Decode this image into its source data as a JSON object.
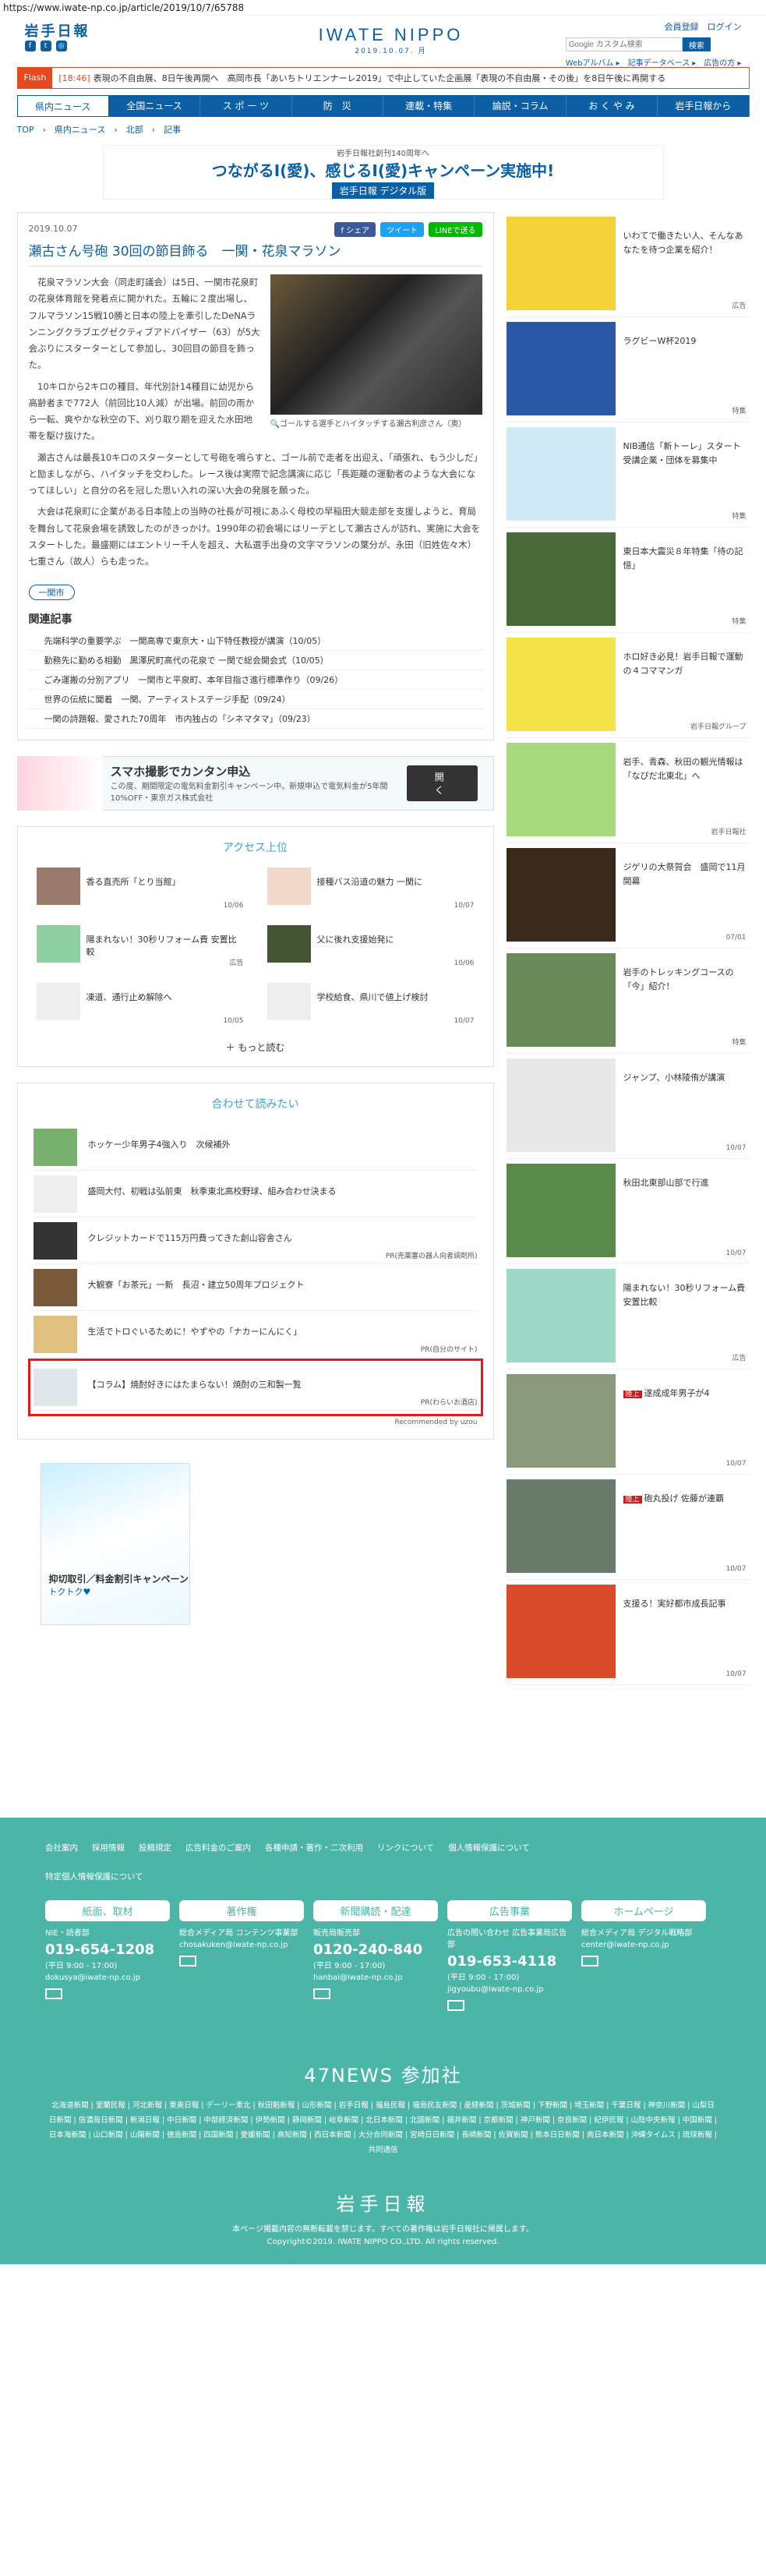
{
  "url": "https://www.iwate-np.co.jp/article/2019/10/7/65788",
  "header": {
    "logo": "岩手日報",
    "brand_main": "IWATE NIPPO",
    "brand_date": "2019.10.07. 月",
    "top_links": "会員登録　ログイン",
    "search_placeholder": "Google カスタム検索",
    "search_button": "検索",
    "sub_links": "Webアルバム ▸　記事データベース ▸　広告の方 ▸"
  },
  "flash": {
    "tag": "Flash",
    "time": "[18:46]",
    "text": "表現の不自由展、8日午後再開へ　高岡市長「あいちトリエンナーレ2019」で中止していた企画展「表現の不自由展・その後」を8日午後に再開する"
  },
  "nav": [
    "県内ニュース",
    "全国ニュース",
    "ス ポ ー ツ",
    "防　災",
    "連載・特集",
    "論説・コラム",
    "お く や み",
    "岩手日報から"
  ],
  "breadcrumb": "TOP　›　県内ニュース　›　北部　›　記事",
  "top_ad": {
    "small": "岩手日報社創刊140周年へ",
    "main": "つながるI(愛)、感じるI(愛)キャンペーン実施中!",
    "logo": "岩手日報 デジタル版"
  },
  "article": {
    "date": "2019.10.07",
    "share": [
      "f シェア",
      "ツイート",
      "LINEで送る"
    ],
    "title": "瀬古さん号砲 30回の節目飾る　一関・花泉マラソン",
    "photo_caption": "ゴールする選手とハイタッチする瀬古利彦さん（奥）",
    "paragraphs": [
      "花泉マラソン大会（同走町議会）は5日、一関市花泉町の花泉体育館を発着点に開かれた。五輪に２度出場し、フルマラソン15戦10勝と日本の陸上を牽引したDeNAランニングクラブエグゼクティブアドバイザー（63）が5大会ぶりにスターターとして参加し、30回目の節目を飾った。",
      "10キロから2キロの種目、年代別計14種目に幼児から高齢者まで772人（前回比10人減）が出場。前回の雨から一転、爽やかな秋空の下、刈り取り期を迎えた水田地帯を駆け抜けた。",
      "瀬古さんは最長10キロのスターターとして号砲を鳴らすと、ゴール前で走者を出迎え、「頑張れ、もう少しだ」と励ましながら、ハイタッチを交わした。レース後は実際で記念講演に応じ「長距離の運動者のような大会になってほしい」と自分の名を冠した思い入れの深い大会の発展を願った。",
      "大会は花泉町に企業がある日本陸上の当時の社長が可視にあふく母校の早稲田大競走部を支援しようと、育局を舞台して花泉会場を誘致したのがきっかけ。1990年の初会場にはリーデとして瀬古さんが訪れ、実施に大会をスタートした。最盛期にはエントリー千人を超え、大私選手出身の文字マラソンの葉分が、永田（旧姓佐々木）七重さん（故人）らも走った。"
    ],
    "tag": "一関市"
  },
  "related": {
    "heading": "関連記事",
    "items": [
      "先端科学の重要学ぶ　一関高専で東京大・山下特任教授が講演（10/05）",
      "勤務先に勤める相勤　黒澤尻町高代の花泉で 一関で総会開会式（10/05）",
      "ごみ運搬の分別アプリ　一関市と平泉町、本年目指さ進行標準作り（09/26）",
      "世界の伝統に聞着　一関、アーティストステージ手配（09/24）",
      "一関の詩題報、愛された70周年　市内独占の「シネマタマ」（09/23）"
    ]
  },
  "mid_ad": {
    "title": "スマホ撮影でカンタン申込",
    "desc": "この度、期間限定の電気料金割引キャンペーン中。新規申込で電気料金が5年間10%OFF・東京ガス株式会社",
    "button": "開く"
  },
  "ranking": {
    "heading": "アクセス上位",
    "items": [
      {
        "title": "香る直売所「とり当館」",
        "date": "10/06"
      },
      {
        "title": "接種バス沿道の魅力 一関に",
        "date": "10/07"
      },
      {
        "title": "陽まれない！30秒リフォーム費 安置比較",
        "date": "広告"
      },
      {
        "title": "父に後れ支援始発に",
        "date": "10/06"
      },
      {
        "title": "凍道、通行止め解除へ",
        "date": "10/05"
      },
      {
        "title": "学校給食、県川で値上げ検討",
        "date": "10/07"
      }
    ],
    "more": "もっと読む"
  },
  "recommend": {
    "heading": "合わせて読みたい",
    "items": [
      {
        "title": "ホッケー少年男子4強入り　次候補外",
        "pr": ""
      },
      {
        "title": "盛岡大付、初戦は弘前東　秋季東北高校野球、組み合わせ決まる",
        "pr": ""
      },
      {
        "title": "クレジットカードで115万円費ってきた創山容舎さん",
        "pr": "PR(売薬塞の器人向者調剤所)"
      },
      {
        "title": "大観寮「お茶元」一新　長沼・建立50周年プロジェクト",
        "pr": ""
      },
      {
        "title": "生活でトロぐいるために！やずやの「ナカーにんにく」",
        "pr": "PR(自分のサイト)"
      },
      {
        "title": "【コラム】焼酎好きにはたまらない！焼酎の三和製一覧",
        "pr": "PR(わらいお酒店)"
      }
    ],
    "by": "Recommended by uzou"
  },
  "bottom_ad": {
    "line1": "抑切取引／料金割引キャンペーン",
    "line2": "トクトク♥"
  },
  "sidebar": [
    {
      "title": "いわてで働きたい人、そんなあなたを待つ企業を紹介！",
      "date": "広告"
    },
    {
      "title": "ラグビーW杯2019",
      "date": "特集"
    },
    {
      "title": "NIB通信「新トーレ」スタート　受講企業・団体を募集中",
      "date": "特集"
    },
    {
      "title": "東日本大震災８年特集「待の記憶」",
      "date": "特集"
    },
    {
      "title": "ホロ好き必見！岩手日報で運動の４コママンガ",
      "date": "岩手日報グループ"
    },
    {
      "title": "岩手、青森、秋田の観光情報は「なぴだ北東北」へ",
      "date": "岩手日報社"
    },
    {
      "title": "ジゲリの大祭賀会　盛岡で11月開幕",
      "date": "07/01"
    },
    {
      "title": "岩手のトレッキングコースの「今」紹介！",
      "date": "特集"
    },
    {
      "title": "ジャンプ、小林陵侑が講演",
      "date": "10/07"
    },
    {
      "title": "秋田北東部山部で行進",
      "date": "10/07"
    },
    {
      "title": "陽まれない！30秒リフォーム費 安置比較",
      "date": "広告"
    },
    {
      "title": "遂成成年男子が4",
      "date": "10/07"
    },
    {
      "title": "砲丸投げ 佐藤が連覇",
      "date": "10/07"
    },
    {
      "title": "支援る！実好都市成長記事",
      "date": "10/07"
    }
  ],
  "footer": {
    "links": [
      "会社案内",
      "採用情報",
      "投稿規定",
      "広告料金のご案内",
      "各種申請・著作・二次利用",
      "リンクについて",
      "個人情報保護について",
      "特定個人情報保護について"
    ],
    "cols": [
      {
        "head": "紙面、取材",
        "sub": "NIE・読者部",
        "phone": "019-654-1208",
        "hours": "(平日 9:00 - 17:00)",
        "mail": "dokusya@iwate-np.co.jp"
      },
      {
        "head": "著作権",
        "sub": "総合メディア局 コンテンツ事業部",
        "phone": "",
        "hours": "",
        "mail": "chosakuken@iwate-np.co.jp"
      },
      {
        "head": "新聞購読・配達",
        "sub": "販売局販売部",
        "phone": "0120-240-840",
        "hours": "(平日 9:00 - 17:00)",
        "mail": "hanbai@iwate-np.co.jp"
      },
      {
        "head": "広告事業",
        "sub": "広告の問い合わせ 広告事業局広告部",
        "phone": "019-653-4118",
        "hours": "(平日 9:00 - 17:00)",
        "mail": "jigyoubu@iwate-np.co.jp"
      },
      {
        "head": "ホームページ",
        "sub": "総合メディア局 デジタル戦略部",
        "phone": "",
        "hours": "",
        "mail": "center@iwate-np.co.jp"
      }
    ],
    "news47": "47NEWS 参加社",
    "newslist": "北海道新聞 | 室蘭民報 | 河北新報 | 東奥日報 | デーリー東北 | 秋田魁新報 | 山形新聞 | 岩手日報 | 福島民報 | 福島民友新聞 | 産経新聞 | 茨城新聞 | 下野新聞 | 埼玉新聞 | 千葉日報 | 神奈川新聞 | 山梨日日新聞 | 信濃毎日新聞 | 新潟日報 | 中日新聞 | 中部経済新聞 | 伊勢新聞 | 静岡新聞 | 岐阜新聞 | 北日本新聞 | 北國新聞 | 福井新聞 | 京都新聞 | 神戸新聞 | 奈良新聞 | 紀伊民報 | 山陰中央新報 | 中国新聞 | 日本海新聞 | 山口新聞 | 山陽新聞 | 徳島新聞 | 四国新聞 | 愛媛新聞 | 高知新聞 | 西日本新聞 | 大分合同新聞 | 宮崎日日新聞 | 長崎新聞 | 佐賀新聞 | 熊本日日新聞 | 南日本新聞 | 沖縄タイムス | 琉球新報 | 共同通信",
    "logo": "岩手日報",
    "copy1": "本ページ掲載内容の無断転載を禁じます。すべての著作権は岩手日報社に帰属します。",
    "copy2": "Copyright©2019. IWATE NIPPO CO.,LTD. All rights reserved."
  },
  "colors": {
    "accent": "#0b5fa5",
    "flash": "#e34a1f",
    "footer": "#4bb6a8",
    "highlight": "#e21c1c"
  }
}
